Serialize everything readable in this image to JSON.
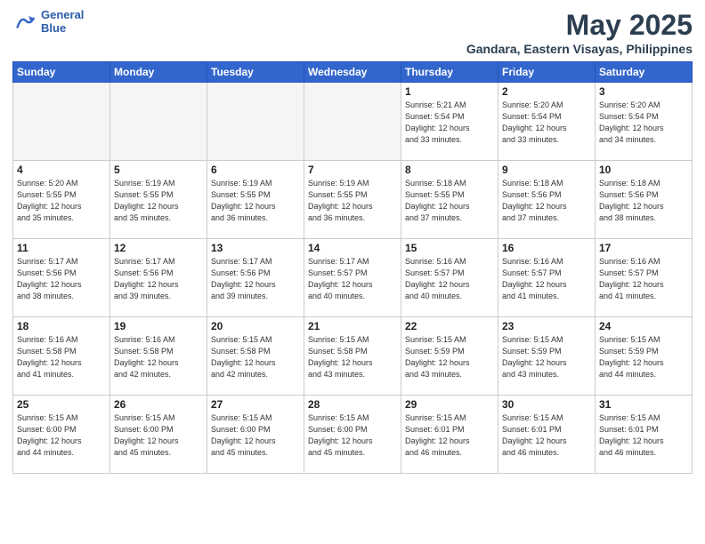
{
  "logo": {
    "line1": "General",
    "line2": "Blue"
  },
  "title": "May 2025",
  "subtitle": "Gandara, Eastern Visayas, Philippines",
  "weekdays": [
    "Sunday",
    "Monday",
    "Tuesday",
    "Wednesday",
    "Thursday",
    "Friday",
    "Saturday"
  ],
  "weeks": [
    [
      {
        "day": "",
        "info": ""
      },
      {
        "day": "",
        "info": ""
      },
      {
        "day": "",
        "info": ""
      },
      {
        "day": "",
        "info": ""
      },
      {
        "day": "1",
        "info": "Sunrise: 5:21 AM\nSunset: 5:54 PM\nDaylight: 12 hours\nand 33 minutes."
      },
      {
        "day": "2",
        "info": "Sunrise: 5:20 AM\nSunset: 5:54 PM\nDaylight: 12 hours\nand 33 minutes."
      },
      {
        "day": "3",
        "info": "Sunrise: 5:20 AM\nSunset: 5:54 PM\nDaylight: 12 hours\nand 34 minutes."
      }
    ],
    [
      {
        "day": "4",
        "info": "Sunrise: 5:20 AM\nSunset: 5:55 PM\nDaylight: 12 hours\nand 35 minutes."
      },
      {
        "day": "5",
        "info": "Sunrise: 5:19 AM\nSunset: 5:55 PM\nDaylight: 12 hours\nand 35 minutes."
      },
      {
        "day": "6",
        "info": "Sunrise: 5:19 AM\nSunset: 5:55 PM\nDaylight: 12 hours\nand 36 minutes."
      },
      {
        "day": "7",
        "info": "Sunrise: 5:19 AM\nSunset: 5:55 PM\nDaylight: 12 hours\nand 36 minutes."
      },
      {
        "day": "8",
        "info": "Sunrise: 5:18 AM\nSunset: 5:55 PM\nDaylight: 12 hours\nand 37 minutes."
      },
      {
        "day": "9",
        "info": "Sunrise: 5:18 AM\nSunset: 5:56 PM\nDaylight: 12 hours\nand 37 minutes."
      },
      {
        "day": "10",
        "info": "Sunrise: 5:18 AM\nSunset: 5:56 PM\nDaylight: 12 hours\nand 38 minutes."
      }
    ],
    [
      {
        "day": "11",
        "info": "Sunrise: 5:17 AM\nSunset: 5:56 PM\nDaylight: 12 hours\nand 38 minutes."
      },
      {
        "day": "12",
        "info": "Sunrise: 5:17 AM\nSunset: 5:56 PM\nDaylight: 12 hours\nand 39 minutes."
      },
      {
        "day": "13",
        "info": "Sunrise: 5:17 AM\nSunset: 5:56 PM\nDaylight: 12 hours\nand 39 minutes."
      },
      {
        "day": "14",
        "info": "Sunrise: 5:17 AM\nSunset: 5:57 PM\nDaylight: 12 hours\nand 40 minutes."
      },
      {
        "day": "15",
        "info": "Sunrise: 5:16 AM\nSunset: 5:57 PM\nDaylight: 12 hours\nand 40 minutes."
      },
      {
        "day": "16",
        "info": "Sunrise: 5:16 AM\nSunset: 5:57 PM\nDaylight: 12 hours\nand 41 minutes."
      },
      {
        "day": "17",
        "info": "Sunrise: 5:16 AM\nSunset: 5:57 PM\nDaylight: 12 hours\nand 41 minutes."
      }
    ],
    [
      {
        "day": "18",
        "info": "Sunrise: 5:16 AM\nSunset: 5:58 PM\nDaylight: 12 hours\nand 41 minutes."
      },
      {
        "day": "19",
        "info": "Sunrise: 5:16 AM\nSunset: 5:58 PM\nDaylight: 12 hours\nand 42 minutes."
      },
      {
        "day": "20",
        "info": "Sunrise: 5:15 AM\nSunset: 5:58 PM\nDaylight: 12 hours\nand 42 minutes."
      },
      {
        "day": "21",
        "info": "Sunrise: 5:15 AM\nSunset: 5:58 PM\nDaylight: 12 hours\nand 43 minutes."
      },
      {
        "day": "22",
        "info": "Sunrise: 5:15 AM\nSunset: 5:59 PM\nDaylight: 12 hours\nand 43 minutes."
      },
      {
        "day": "23",
        "info": "Sunrise: 5:15 AM\nSunset: 5:59 PM\nDaylight: 12 hours\nand 43 minutes."
      },
      {
        "day": "24",
        "info": "Sunrise: 5:15 AM\nSunset: 5:59 PM\nDaylight: 12 hours\nand 44 minutes."
      }
    ],
    [
      {
        "day": "25",
        "info": "Sunrise: 5:15 AM\nSunset: 6:00 PM\nDaylight: 12 hours\nand 44 minutes."
      },
      {
        "day": "26",
        "info": "Sunrise: 5:15 AM\nSunset: 6:00 PM\nDaylight: 12 hours\nand 45 minutes."
      },
      {
        "day": "27",
        "info": "Sunrise: 5:15 AM\nSunset: 6:00 PM\nDaylight: 12 hours\nand 45 minutes."
      },
      {
        "day": "28",
        "info": "Sunrise: 5:15 AM\nSunset: 6:00 PM\nDaylight: 12 hours\nand 45 minutes."
      },
      {
        "day": "29",
        "info": "Sunrise: 5:15 AM\nSunset: 6:01 PM\nDaylight: 12 hours\nand 46 minutes."
      },
      {
        "day": "30",
        "info": "Sunrise: 5:15 AM\nSunset: 6:01 PM\nDaylight: 12 hours\nand 46 minutes."
      },
      {
        "day": "31",
        "info": "Sunrise: 5:15 AM\nSunset: 6:01 PM\nDaylight: 12 hours\nand 46 minutes."
      }
    ]
  ]
}
